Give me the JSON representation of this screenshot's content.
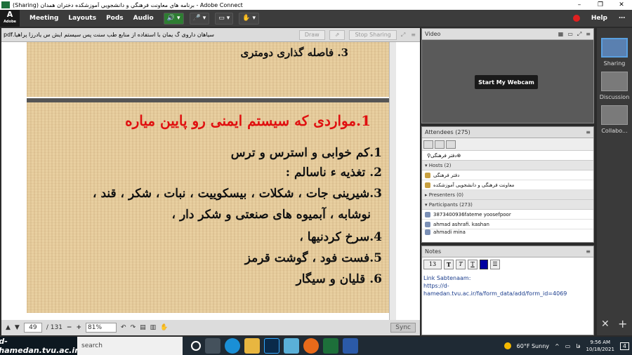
{
  "window": {
    "title": "(Sharing) برنامه هاي معاونت فرهنگي و دانشجويي آموزشکده دختران همدان - Adobe Connect"
  },
  "menu": {
    "items": [
      "Meeting",
      "Layouts",
      "Pods",
      "Audio"
    ],
    "help": "Help"
  },
  "share": {
    "document": "سیاهان داروی گ یمان با استفاده از منابع طب سنت پس سیستم ایش س یادرزا پراهیا.pdf",
    "buttons": {
      "draw": "Draw",
      "stop": "Stop Sharing"
    },
    "slide_top_line": "3.  فاصله گذاری  دومتری",
    "slide_heading": "1.مواردی که سیستم ایمنی رو پایین میاره",
    "slide_lines": [
      "1.کم خوابی و استرس و ترس",
      "2. تغذیه ء ناسالم :",
      "3.شیرینی جات ، شکلات ، بیسکوییت ، نبات ، شکر ، قند ،",
      "نوشابه ، آبمیوه های صنعتی و شکر دار ،",
      "4.سرخ کردنیها ،",
      "5.فست فود ، گوشت قرمز",
      "6. قلیان و سیگار"
    ],
    "page_current": "49",
    "page_total": "/ 131",
    "zoom": "81%",
    "sync": "Sync"
  },
  "video": {
    "title": "Video",
    "webcam_button": "Start My Webcam"
  },
  "attendees": {
    "title": "Attendees",
    "count": "(275)",
    "search_value": "دفتر فرهنگی",
    "hosts_label": "Hosts (2)",
    "hosts": [
      "دفتر فرهنگی",
      "معاونت فرهنگی و دانشجویی آموزشکده"
    ],
    "presenters_label": "Presenters (0)",
    "participants_label": "Participants (273)",
    "participants": [
      "3873400936fateme yoosefpoor",
      "ahmad ashrafi. kashan",
      "ahmadi mina"
    ]
  },
  "notes": {
    "title": "Notes",
    "font_size": "13",
    "line1": "Link Sabtenaam:",
    "line2": "https://d-hamedan.tvu.ac.ir/fa/form_data/add/form_id=4069"
  },
  "layouts_bar": {
    "items": [
      "Sharing",
      "Discussion",
      "Collabo..."
    ]
  },
  "taskbar": {
    "brand": "d-hamedan.tvu.ac.ir",
    "search": "search",
    "weather": "60°F  Sunny",
    "lang": "فا",
    "time": "9:56 AM",
    "date": "10/18/2021",
    "notif_count": "4"
  },
  "colors": {
    "accent_red": "#e01010",
    "slide_bg": "#e8cfa0",
    "link_blue": "#1a3c8c"
  }
}
